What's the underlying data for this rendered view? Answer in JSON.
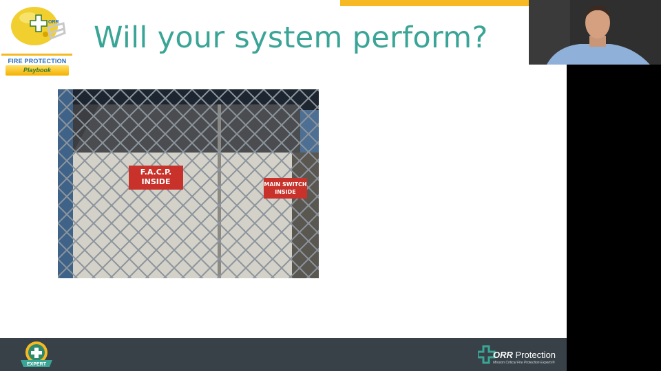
{
  "slide": {
    "title": "Will your system perform?",
    "accent_color": "#3aa596",
    "top_bar_color": "#f6b823"
  },
  "logo_top_left": {
    "line1": "FIRE PROTECTION",
    "line2": "Playbook",
    "helmet_label": "ORR"
  },
  "photo": {
    "sign_1": "F.A.C.P.\nINSIDE",
    "sign_2": "MAIN SWITCH\nINSIDE"
  },
  "bottom_bar": {
    "badge_label": "EXPERT",
    "brand_name": "ORR",
    "brand_suffix": " Protection",
    "tagline": "Mission Critical Fire Protection Experts®",
    "bar_color": "#374147"
  },
  "webcam": {
    "presenter": "presenter video feed"
  }
}
